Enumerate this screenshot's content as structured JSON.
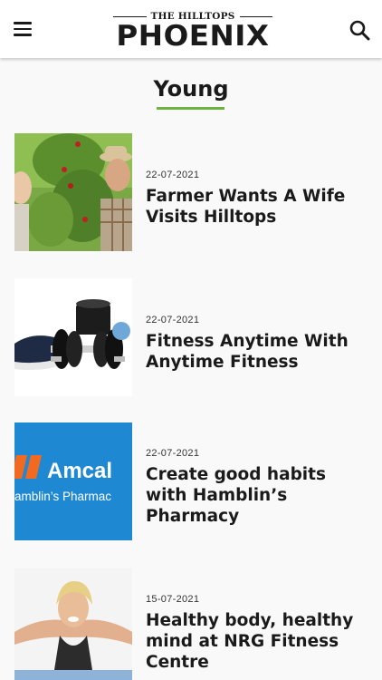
{
  "header": {
    "menu_icon": "hamburger-menu-icon",
    "logo_top": "THE HILLTOPS",
    "logo_main": "PHOENIX",
    "search_icon": "search-icon"
  },
  "section": {
    "title": "Young",
    "accent_color": "#6cb33f"
  },
  "articles": [
    {
      "date": "22-07-2021",
      "title": "Farmer Wants A Wife Visits Hilltops"
    },
    {
      "date": "22-07-2021",
      "title": "Fitness Anytime With Anytime Fitness"
    },
    {
      "date": "22-07-2021",
      "title": "Create good habits with Hamblin’s Pharmacy",
      "thumb_text_1": "Amcal",
      "thumb_text_2": "amblin’s Pharmac"
    },
    {
      "date": "15-07-2021",
      "title": "Healthy body, healthy mind at NRG Fitness Centre"
    }
  ]
}
